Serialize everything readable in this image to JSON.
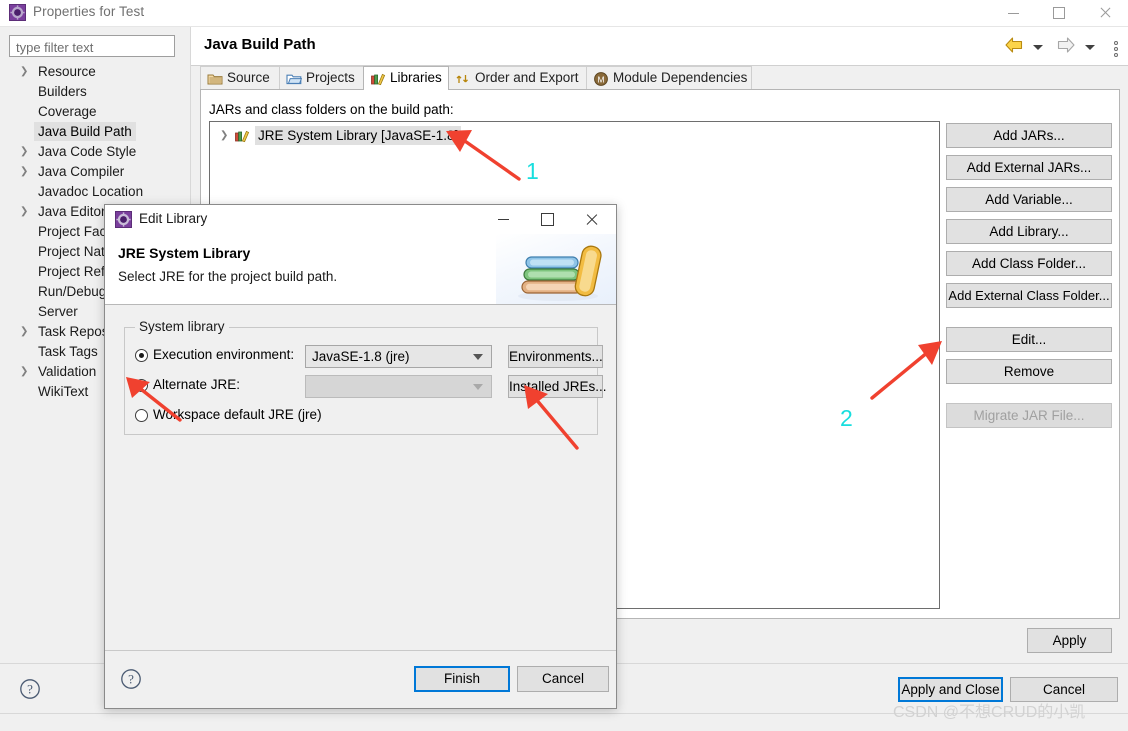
{
  "window": {
    "title": "Properties for Test",
    "icon": "eclipse-icon",
    "minimize": "–",
    "maximize": "□",
    "close": "✕"
  },
  "sidebar": {
    "filter": {
      "placeholder": "type filter text",
      "value": ""
    },
    "items": [
      {
        "label": "Resource",
        "expandable": true,
        "selected": false
      },
      {
        "label": "Builders",
        "expandable": false,
        "selected": false
      },
      {
        "label": "Coverage",
        "expandable": false,
        "selected": false
      },
      {
        "label": "Java Build Path",
        "expandable": false,
        "selected": true
      },
      {
        "label": "Java Code Style",
        "expandable": true,
        "selected": false
      },
      {
        "label": "Java Compiler",
        "expandable": true,
        "selected": false
      },
      {
        "label": "Javadoc Location",
        "expandable": false,
        "selected": false
      },
      {
        "label": "Java Editor",
        "expandable": true,
        "selected": false
      },
      {
        "label": "Project Facets",
        "expandable": false,
        "selected": false
      },
      {
        "label": "Project Natures",
        "expandable": false,
        "selected": false
      },
      {
        "label": "Project References",
        "expandable": false,
        "selected": false
      },
      {
        "label": "Run/Debug Settings",
        "expandable": false,
        "selected": false
      },
      {
        "label": "Server",
        "expandable": false,
        "selected": false
      },
      {
        "label": "Task Repositories",
        "expandable": true,
        "selected": false
      },
      {
        "label": "Task Tags",
        "expandable": false,
        "selected": false
      },
      {
        "label": "Validation",
        "expandable": true,
        "selected": false
      },
      {
        "label": "WikiText",
        "expandable": false,
        "selected": false
      }
    ],
    "help_icon": "help-question-icon"
  },
  "main": {
    "page_title": "Java Build Path",
    "nav": {
      "back_icon": "back-arrow-icon",
      "back_dropdown_icon": "chevron-down-icon",
      "forward_icon": "forward-arrow-icon",
      "forward_dropdown_icon": "chevron-down-icon",
      "menu_icon": "vertical-dots-icon"
    },
    "tabs": [
      {
        "label": "Source",
        "icon": "source-folder-icon",
        "active": false
      },
      {
        "label": "Projects",
        "icon": "projects-folder-icon",
        "active": false
      },
      {
        "label": "Libraries",
        "icon": "libraries-books-icon",
        "active": true
      },
      {
        "label": "Order and Export",
        "icon": "order-export-icon",
        "active": false
      },
      {
        "label": "Module Dependencies",
        "icon": "module-icon",
        "active": false
      }
    ],
    "list_label": "JARs and class folders on the build path:",
    "list_items": [
      {
        "label": "JRE System Library [JavaSE-1.8]",
        "icon": "libraries-books-icon",
        "expandable": true,
        "selected": true
      }
    ],
    "buttons": [
      {
        "label": "Add JARs...",
        "disabled": false
      },
      {
        "label": "Add External JARs...",
        "disabled": false
      },
      {
        "label": "Add Variable...",
        "disabled": false
      },
      {
        "label": "Add Library...",
        "disabled": false
      },
      {
        "label": "Add Class Folder...",
        "disabled": false
      },
      {
        "label": "Add External Class Folder...",
        "disabled": false
      },
      {
        "label": "Edit...",
        "disabled": false
      },
      {
        "label": "Remove",
        "disabled": false
      },
      {
        "label": "Migrate JAR File...",
        "disabled": true
      }
    ],
    "apply_label": "Apply",
    "apply_and_close_label": "Apply and Close",
    "cancel_label": "Cancel"
  },
  "dialog": {
    "title": "Edit Library",
    "icon": "eclipse-icon",
    "header_title": "JRE System Library",
    "header_subtitle": "Select JRE for the project build path.",
    "header_art": "books-stack-illustration",
    "group_legend": "System library",
    "options": [
      {
        "label": "Execution environment:",
        "selected": true,
        "combo_value": "JavaSE-1.8 (jre)",
        "combo_disabled": false,
        "side_button": "Environments..."
      },
      {
        "label": "Alternate JRE:",
        "selected": false,
        "combo_value": "",
        "combo_disabled": true,
        "side_button": "Installed JREs..."
      },
      {
        "label": "Workspace default JRE (jre)",
        "selected": false
      }
    ],
    "help_icon": "help-question-icon",
    "finish_label": "Finish",
    "cancel_label": "Cancel",
    "minimize": "–",
    "maximize": "□",
    "close": "✕"
  },
  "annotations": [
    {
      "number": "1",
      "color": "#18dede"
    },
    {
      "number": "2",
      "color": "#18dede"
    }
  ],
  "watermark": "CSDN @不想CRUD的小凯",
  "colors": {
    "accent": "#0078d7",
    "annotation": "#18dede",
    "arrow": "#f0412f",
    "selection": "#e0e0e0"
  }
}
